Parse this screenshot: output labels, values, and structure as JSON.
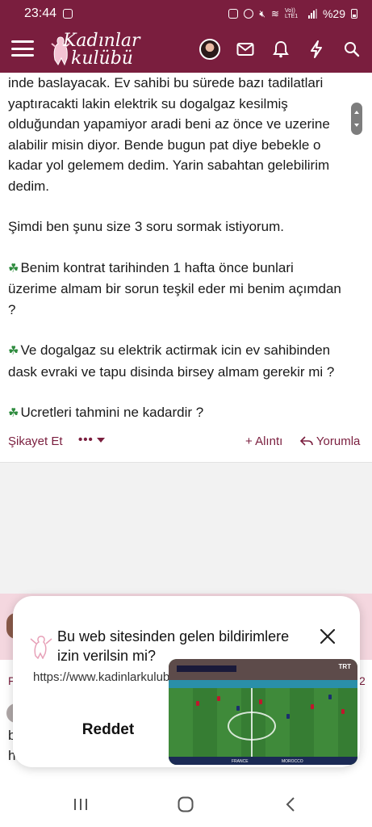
{
  "statusbar": {
    "time": "23:44",
    "network": "Vo)) LTE1",
    "battery": "%29"
  },
  "header": {
    "logo_line1": "Kadınlar",
    "logo_line2": "kulübü"
  },
  "post": {
    "lines": [
      "inde baslayacak. Ev sahibi bu sürede bazı tadilatlari",
      "yaptıracakti lakin elektrik su dogalgaz kesilmiş",
      "olduğundan yapamiyor aradi beni az önce ve uzerine",
      "alabilir misin diyor. Bende bugun pat diye bebekle o",
      "kadar yol gelemem dedim. Yarin sabahtan gelebilirim",
      "dedim."
    ],
    "intro": "Şimdi ben şunu size 3 soru sormak istiyorum.",
    "question1_line1": "Benim kontrat tarihinden 1 hafta önce bunlari",
    "question1_line2": "üzerime almam bir sorun teşkil eder mi benim açımdan",
    "question1_line3": "?",
    "question2_line1": "Ve dogalgaz su elektrik actirmak icin ev sahibinden",
    "question2_line2": "dask evraki ve tapu disinda birsey almam gerekir mi ?",
    "question3": "Ucretleri tahmini ne kadardir ?"
  },
  "actions": {
    "report": "Şikayet Et",
    "more": "•••",
    "quote": "+ Alıntı",
    "reply": "Yorumla"
  },
  "next_post_fragments": {
    "a": "F",
    "b": "2",
    "c": "b",
    "d": "h"
  },
  "permission_popup": {
    "title": "Bu web sitesinden gelen bildirimlere izin verilsin mi?",
    "url": "https://www.kadinlarkulubu.com",
    "deny": "Reddet"
  },
  "pip_video": {
    "broadcaster": "TRT",
    "team_left": "FRANCE",
    "team_right": "MOROCCO"
  },
  "colors": {
    "brand": "#7a1e3e",
    "clover": "#2e8b3e"
  },
  "icons": [
    "menu-icon",
    "mail-icon",
    "bell-icon",
    "lightning-icon",
    "search-icon",
    "clover-icon",
    "close-icon",
    "recent-apps-icon",
    "home-icon",
    "back-icon"
  ]
}
